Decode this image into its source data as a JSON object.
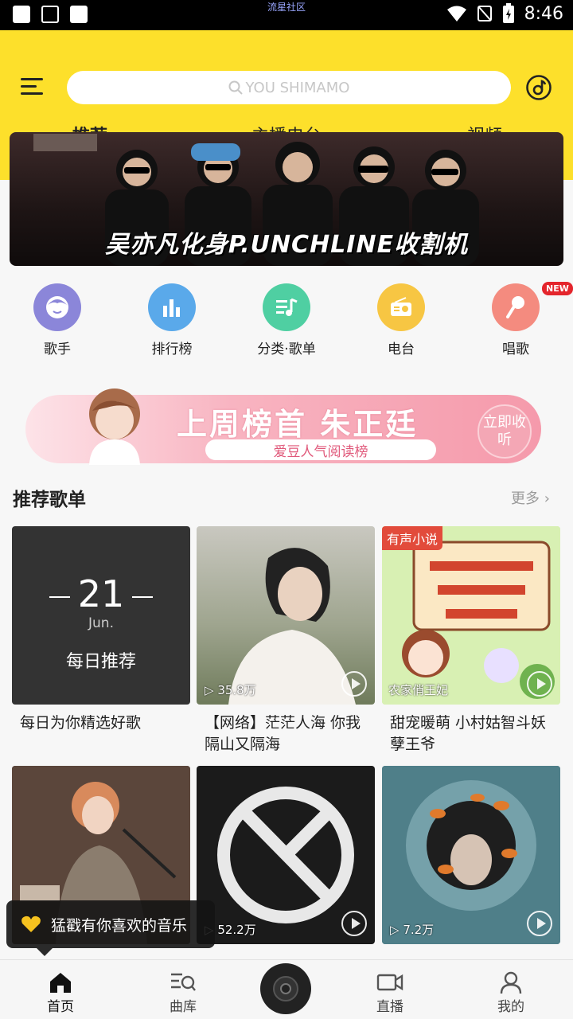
{
  "status_bar": {
    "center_text": "流星社区",
    "time": "8:46"
  },
  "header": {
    "search_placeholder": "YOU SHIMAMO",
    "tabs": [
      {
        "label": "推荐",
        "active": true
      },
      {
        "label": "主播电台",
        "active": false
      },
      {
        "label": "视频",
        "active": false
      }
    ]
  },
  "banner": {
    "headline": "吴亦凡化身P.UNCHLINE收割机"
  },
  "entries": [
    {
      "label": "歌手",
      "color": "#8b86d9"
    },
    {
      "label": "排行榜",
      "color": "#5aa9ea"
    },
    {
      "label": "分类·歌单",
      "color": "#4fcfa2"
    },
    {
      "label": "电台",
      "color": "#f7c643"
    },
    {
      "label": "唱歌",
      "color": "#f48b7f",
      "badge": "NEW"
    }
  ],
  "promo": {
    "title": "上周榜首 朱正廷",
    "subtitle": "爱豆人气阅读榜",
    "cta": "立即收听"
  },
  "playlists": {
    "title": "推荐歌单",
    "more_label": "更多",
    "items": [
      {
        "caption": "每日为你精选好歌",
        "day": "21",
        "month": "Jun.",
        "cover_label": "每日推荐"
      },
      {
        "caption": "【网络】茫茫人海 你我隔山又隔海",
        "play_count": "35.8万"
      },
      {
        "caption": "甜宠暖萌 小村姑智斗妖孽王爷",
        "tag": "有声小说",
        "cover_subtitle": "农家俏王妃"
      },
      {
        "caption": "",
        "play_count": ""
      },
      {
        "caption": "",
        "play_count": "52.2万"
      },
      {
        "caption": "",
        "play_count": "7.2万"
      }
    ]
  },
  "toast": {
    "text": "猛戳有你喜欢的音乐"
  },
  "tabbar": [
    {
      "label": "首页",
      "active": true
    },
    {
      "label": "曲库",
      "active": false
    },
    {
      "label": "直播",
      "active": false
    },
    {
      "label": "我的",
      "active": false
    }
  ],
  "colors": {
    "brand_yellow": "#fde02b",
    "badge_red": "#e4252c"
  }
}
